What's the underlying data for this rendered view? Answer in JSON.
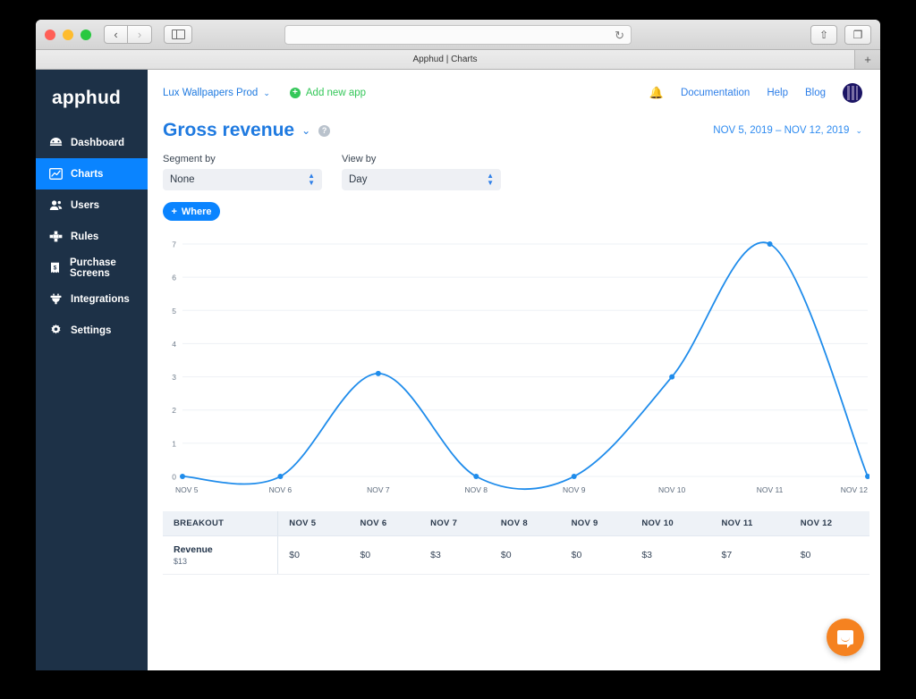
{
  "browser": {
    "tab_title": "Apphud | Charts",
    "address_value": "",
    "address_placeholder": "",
    "reload_icon": "reload-icon",
    "back_icon": "‹",
    "forward_icon": "›",
    "share_icon": "⇧",
    "tabs_icon": "❐",
    "newtab_label": "+"
  },
  "sidebar": {
    "logo": "apphud",
    "items": [
      {
        "label": "Dashboard",
        "icon": "speedometer-icon",
        "active": false
      },
      {
        "label": "Charts",
        "icon": "line-chart-icon",
        "active": true
      },
      {
        "label": "Users",
        "icon": "users-icon",
        "active": false
      },
      {
        "label": "Rules",
        "icon": "puzzle-icon",
        "active": false
      },
      {
        "label": "Purchase Screens",
        "icon": "receipt-icon",
        "active": false
      },
      {
        "label": "Integrations",
        "icon": "plug-icon",
        "active": false
      },
      {
        "label": "Settings",
        "icon": "gear-icon",
        "active": false
      }
    ]
  },
  "topbar": {
    "app_selector": "Lux Wallpapers Prod",
    "app_selector_chevron": "⌄",
    "add_new_app": "Add new app",
    "add_icon_glyph": "+",
    "bell_icon": "🔔",
    "links": [
      {
        "label": "Documentation"
      },
      {
        "label": "Help"
      },
      {
        "label": "Blog"
      }
    ],
    "avatar": "user-avatar"
  },
  "page": {
    "title": "Gross revenue",
    "title_chevron": "⌄",
    "help_icon_glyph": "?",
    "date_range": "NOV 5, 2019  –  NOV 12, 2019",
    "date_range_chevron": "⌄"
  },
  "filters": {
    "segment_by_label": "Segment by",
    "segment_by_value": "None",
    "view_by_label": "View by",
    "view_by_value": "Day",
    "spinner_glyph": "⇵",
    "where_button": "Where",
    "where_plus": "+"
  },
  "chart_data": {
    "type": "line",
    "title": "Gross revenue",
    "xlabel": "",
    "ylabel": "",
    "x": [
      "NOV 5",
      "NOV 6",
      "NOV 7",
      "NOV 8",
      "NOV 9",
      "NOV 10",
      "NOV 11",
      "NOV 12"
    ],
    "values": [
      0,
      0,
      3.1,
      0,
      0,
      3,
      7,
      0
    ],
    "ylim": [
      0,
      7
    ],
    "yticks": [
      0,
      1,
      2,
      3,
      4,
      5,
      6,
      7
    ],
    "grid": true,
    "legend": false,
    "line_color": "#1f8ceb",
    "point_color": "#1f8ceb",
    "interpolation": "smooth"
  },
  "table": {
    "columns": [
      "BREAKOUT",
      "NOV 5",
      "NOV 6",
      "NOV 7",
      "NOV 8",
      "NOV 9",
      "NOV 10",
      "NOV 11",
      "NOV 12"
    ],
    "rows": [
      {
        "name": "Revenue",
        "total": "$13",
        "cells": [
          "$0",
          "$0",
          "$3",
          "$0",
          "$0",
          "$3",
          "$7",
          "$0"
        ]
      }
    ]
  },
  "widgets": {
    "intercom_label": "chat-bubble"
  },
  "colors": {
    "accent_blue": "#0a84ff",
    "sidebar_bg": "#1d3147",
    "link_blue": "#2e7fe8",
    "green": "#34c759",
    "intercom_orange": "#f58220"
  }
}
